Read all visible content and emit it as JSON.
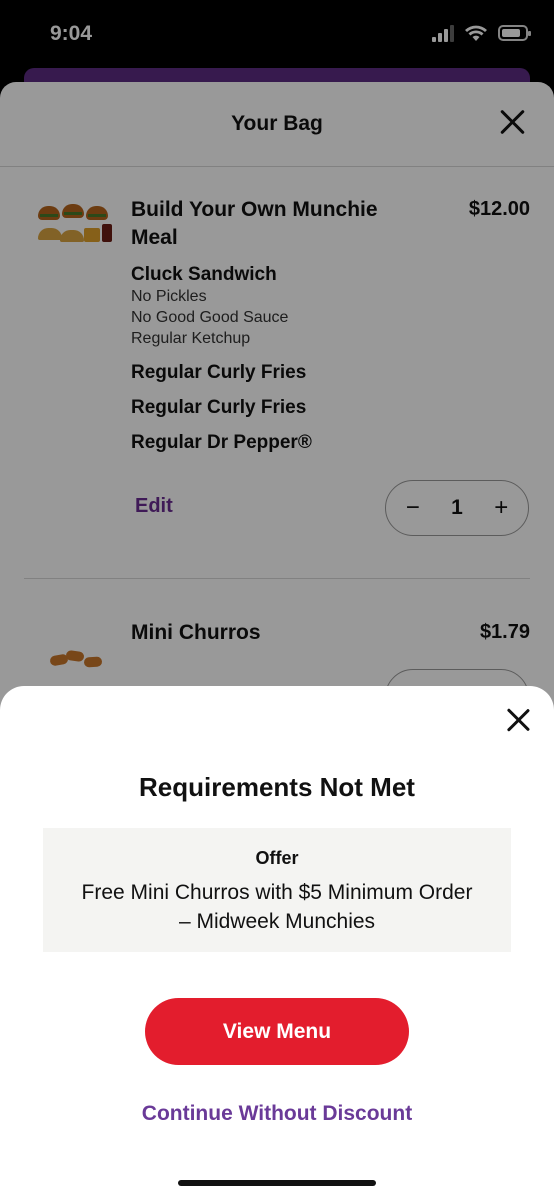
{
  "status_bar": {
    "time": "9:04"
  },
  "bag": {
    "title": "Your Bag",
    "items": [
      {
        "name": "Build Your Own Munchie Meal",
        "price": "$12.00",
        "modifiers": [
          {
            "name": "Cluck Sandwich",
            "details": [
              "No Pickles",
              "No Good Good Sauce",
              "Regular Ketchup"
            ]
          },
          {
            "name": "Regular Curly Fries",
            "details": []
          },
          {
            "name": "Regular Curly Fries",
            "details": []
          },
          {
            "name": "Regular Dr Pepper®",
            "details": []
          }
        ],
        "edit_label": "Edit",
        "quantity": "1"
      },
      {
        "name": "Mini Churros",
        "price": "$1.79"
      }
    ]
  },
  "modal": {
    "title": "Requirements Not Met",
    "offer_label": "Offer",
    "offer_description": "Free Mini Churros with $5 Minimum Order – Midweek Munchies",
    "primary_button": "View Menu",
    "secondary_link": "Continue Without Discount"
  },
  "stepper": {
    "minus": "−",
    "plus": "+"
  },
  "colors": {
    "brand_red": "#e31d2d",
    "brand_purple": "#6a2c91"
  },
  "icons": [
    "signal-icon",
    "wifi-icon",
    "battery-icon",
    "close-icon",
    "minus-icon",
    "plus-icon"
  ]
}
